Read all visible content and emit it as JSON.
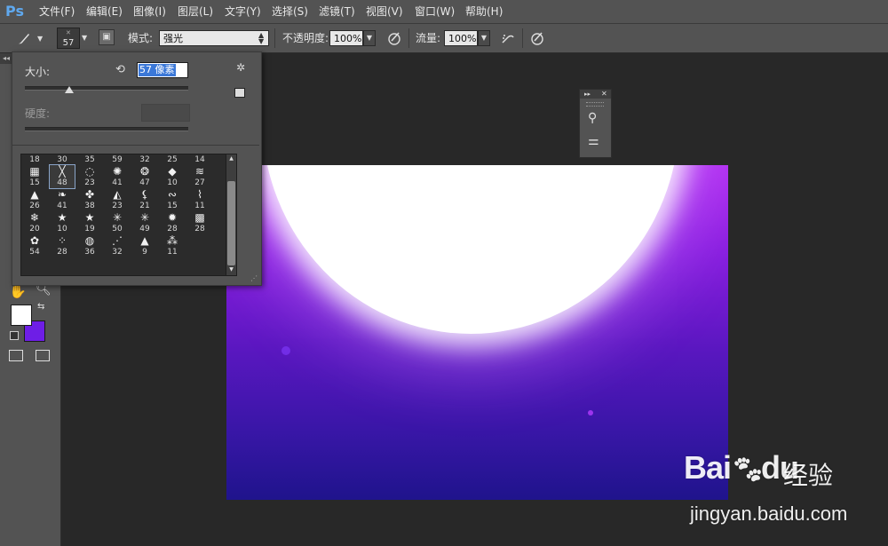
{
  "app": {
    "logo": "Ps"
  },
  "menu": [
    "文件(F)",
    "编辑(E)",
    "图像(I)",
    "图层(L)",
    "文字(Y)",
    "选择(S)",
    "滤镜(T)",
    "视图(V)",
    "窗口(W)",
    "帮助(H)"
  ],
  "options": {
    "brush_size": "57",
    "mode_label": "模式:",
    "mode_value": "强光",
    "opacity_label": "不透明度:",
    "opacity_value": "100%",
    "flow_label": "流量:",
    "flow_value": "100%"
  },
  "brush_panel": {
    "size_label": "大小:",
    "size_value": "57 像素",
    "size_fraction": 0.27,
    "hardness_label": "硬度:",
    "top_row": [
      "18",
      "30",
      "35",
      "59",
      "32",
      "25",
      "14"
    ],
    "rows": [
      [
        {
          "g": "▦",
          "n": "15"
        },
        {
          "g": "╳",
          "n": "48",
          "selected": true
        },
        {
          "g": "◌",
          "n": "23"
        },
        {
          "g": "✺",
          "n": "41"
        },
        {
          "g": "❂",
          "n": "47"
        },
        {
          "g": "◆",
          "n": "10"
        },
        {
          "g": "≋",
          "n": "27"
        }
      ],
      [
        {
          "g": "▲",
          "n": "26"
        },
        {
          "g": "❧",
          "n": "41"
        },
        {
          "g": "✤",
          "n": "38"
        },
        {
          "g": "◭",
          "n": "23"
        },
        {
          "g": "⚸",
          "n": "21"
        },
        {
          "g": "∾",
          "n": "15"
        },
        {
          "g": "⌇",
          "n": "11"
        }
      ],
      [
        {
          "g": "❄",
          "n": "20"
        },
        {
          "g": "★",
          "n": "10"
        },
        {
          "g": "★",
          "n": "19"
        },
        {
          "g": "✳",
          "n": "50"
        },
        {
          "g": "✳",
          "n": "49"
        },
        {
          "g": "✹",
          "n": "28"
        },
        {
          "g": "▩",
          "n": "28"
        }
      ],
      [
        {
          "g": "✿",
          "n": "54"
        },
        {
          "g": "⁘",
          "n": "28"
        },
        {
          "g": "◍",
          "n": "36"
        },
        {
          "g": "⋰",
          "n": "32"
        },
        {
          "g": "▲",
          "n": "9"
        },
        {
          "g": "⁂",
          "n": "11"
        }
      ]
    ]
  },
  "watermark": {
    "logo": "Bai",
    "logo2": "du",
    "text": "经验",
    "url": "jingyan.baidu.com"
  }
}
